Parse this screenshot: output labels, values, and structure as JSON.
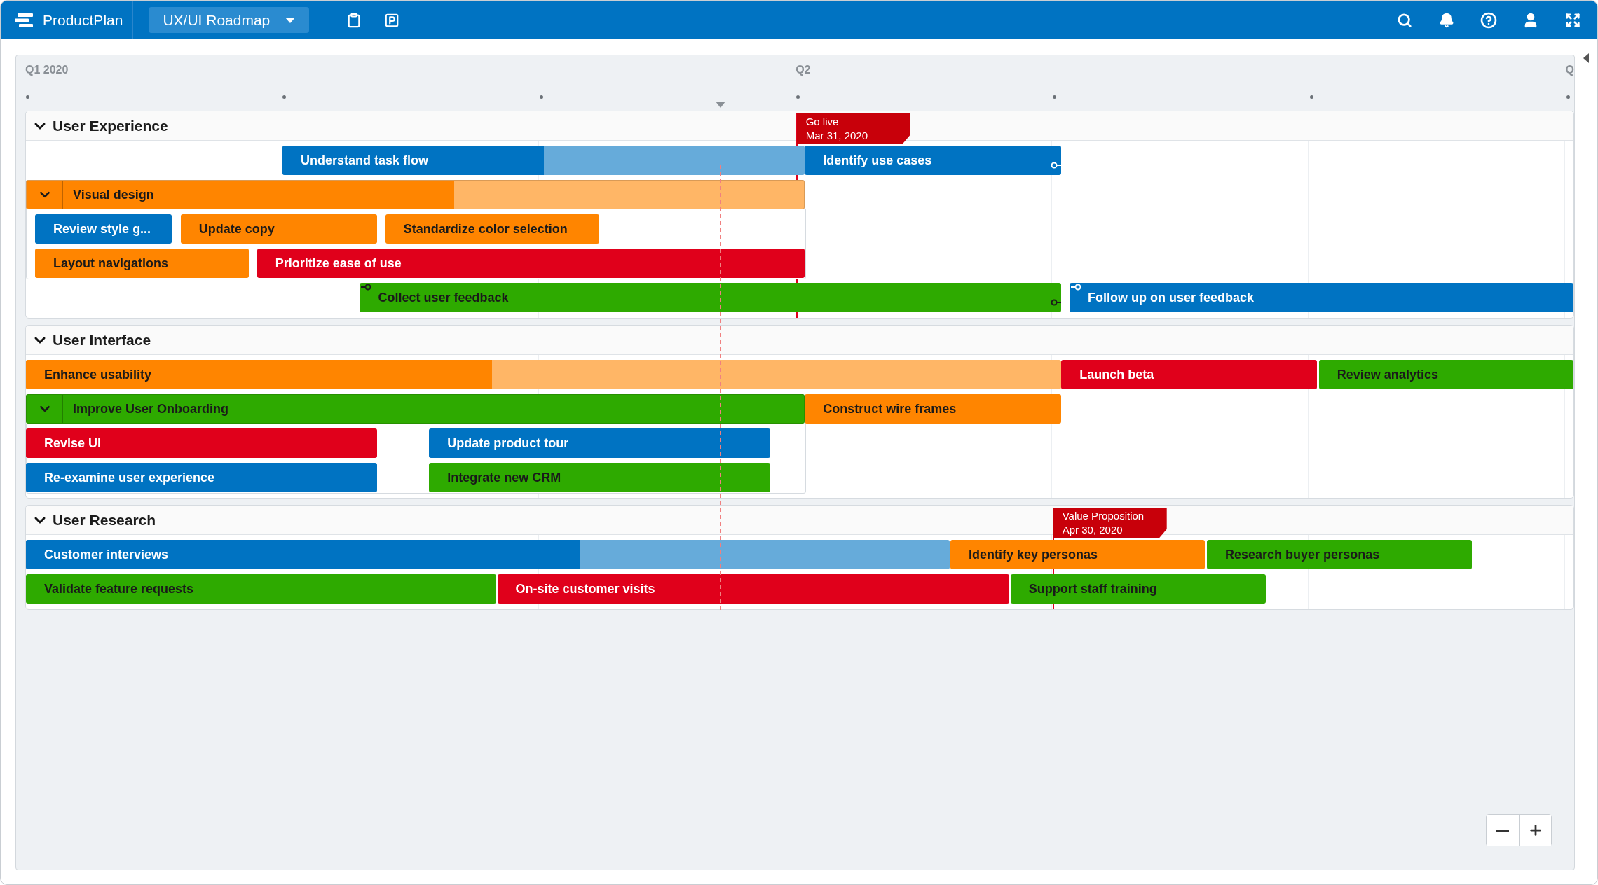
{
  "app": {
    "name": "ProductPlan",
    "roadmap": "UX/UI Roadmap"
  },
  "timeline": {
    "quarters": [
      "Q1 2020",
      "Q2",
      "Q"
    ]
  },
  "lanes": [
    {
      "title": "User Experience",
      "expanded": true,
      "milestone": {
        "title": "Go live",
        "date": "Mar 31, 2020"
      },
      "tracks": [
        {
          "bars": [
            {
              "kind": "bar",
              "label": "Understand task flow",
              "color": "#0073c2",
              "level": 0.5
            },
            {
              "kind": "bar",
              "label": "Identify use cases",
              "color": "#0073c2",
              "dependency_end": true
            }
          ]
        },
        {
          "bars": [
            {
              "kind": "container",
              "label": "Visual design",
              "color": "#ff8500",
              "level": 0.55,
              "expanded": true,
              "tracks": [
                {
                  "bars": [
                    {
                      "kind": "bar",
                      "label": "Review style g...",
                      "color": "#0073c2"
                    },
                    {
                      "kind": "bar",
                      "label": "Update copy",
                      "color": "#ff8500"
                    },
                    {
                      "kind": "bar",
                      "label": "Standardize color selection",
                      "color": "#ff8500"
                    }
                  ]
                },
                {
                  "bars": [
                    {
                      "kind": "bar",
                      "label": "Layout navigations",
                      "color": "#ff8500"
                    },
                    {
                      "kind": "bar",
                      "label": "Prioritize ease of use",
                      "color": "#e0001b"
                    }
                  ]
                }
              ]
            }
          ]
        },
        {
          "bars": [
            {
              "kind": "bar",
              "label": "Collect user feedback",
              "color": "#2eaa00",
              "dependency_start": true,
              "dependency_end": true
            },
            {
              "kind": "bar",
              "label": "Follow up on user feedback",
              "color": "#0073c2",
              "dependency_start": true
            }
          ]
        }
      ]
    },
    {
      "title": "User Interface",
      "expanded": true,
      "tracks": [
        {
          "bars": [
            {
              "kind": "bar",
              "label": "Enhance usability",
              "color": "#ff8500",
              "level": 0.45
            },
            {
              "kind": "bar",
              "label": "Launch beta",
              "color": "#e0001b"
            },
            {
              "kind": "bar",
              "label": "Review analytics",
              "color": "#2eaa00"
            }
          ]
        },
        {
          "bars": [
            {
              "kind": "container",
              "label": "Improve User Onboarding",
              "color": "#2eaa00",
              "expanded": true,
              "tracks": [
                {
                  "bars": [
                    {
                      "kind": "bar",
                      "label": "Revise UI",
                      "color": "#e0001b"
                    },
                    {
                      "kind": "bar",
                      "label": "Update product tour",
                      "color": "#0073c2"
                    }
                  ]
                },
                {
                  "bars": [
                    {
                      "kind": "bar",
                      "label": "Re-examine user experience",
                      "color": "#0073c2"
                    },
                    {
                      "kind": "bar",
                      "label": "Integrate new CRM",
                      "color": "#2eaa00"
                    }
                  ]
                }
              ]
            },
            {
              "kind": "bar",
              "label": "Construct wire frames",
              "color": "#ff8500"
            }
          ]
        }
      ]
    },
    {
      "title": "User Research",
      "expanded": true,
      "milestone": {
        "title": "Value Proposition",
        "date": "Apr 30, 2020"
      },
      "tracks": [
        {
          "bars": [
            {
              "kind": "bar",
              "label": "Customer interviews",
              "color": "#0073c2",
              "level": 0.6
            },
            {
              "kind": "bar",
              "label": "Identify key personas",
              "color": "#ff8500"
            },
            {
              "kind": "bar",
              "label": "Research buyer personas",
              "color": "#2eaa00"
            }
          ]
        },
        {
          "bars": [
            {
              "kind": "bar",
              "label": "Validate feature requests",
              "color": "#2eaa00"
            },
            {
              "kind": "bar",
              "label": "On-site customer visits",
              "color": "#e0001b"
            },
            {
              "kind": "bar",
              "label": "Support staff training",
              "color": "#2eaa00"
            }
          ]
        }
      ]
    }
  ]
}
